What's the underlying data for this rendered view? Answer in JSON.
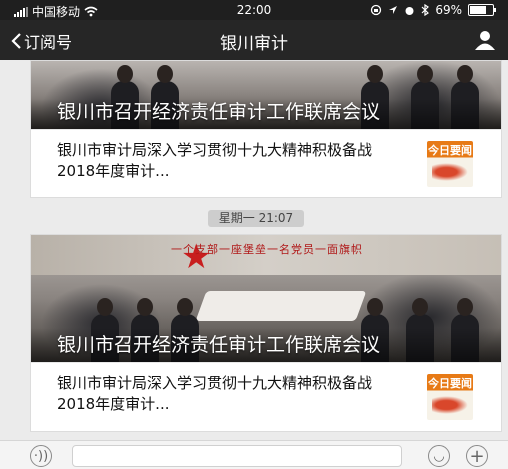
{
  "status_bar": {
    "carrier": "中国移动",
    "time": "22:00",
    "battery": "69%",
    "battery_level": 0.69
  },
  "nav": {
    "back_label": "订阅号",
    "title": "银川审计",
    "back_icon": "chevron-left-icon",
    "profile_icon": "person-icon"
  },
  "messages": [
    {
      "main_title": "银川市召开经济责任审计工作联席会议",
      "sub_title": "银川市审计局深入学习贯彻十九大精神积极备战2018年度审计...",
      "thumb_text": "今日要闻"
    },
    {
      "time_label": "星期一 21:07",
      "banner_text": "一个支部一座堡垒一名党员一面旗帜",
      "main_title": "银川市召开经济责任审计工作联席会议",
      "sub_title": "银川市审计局深入学习贯彻十九大精神积极备战2018年度审计...",
      "thumb_text": "今日要闻"
    }
  ],
  "input_bar": {
    "voice_icon": "voice-icon",
    "emoji_icon": "emoji-icon",
    "plus_icon": "plus-icon"
  },
  "colors": {
    "nav_bg": "#262626",
    "thumb_accent": "#e77a16",
    "banner_red": "#c81e1e"
  }
}
